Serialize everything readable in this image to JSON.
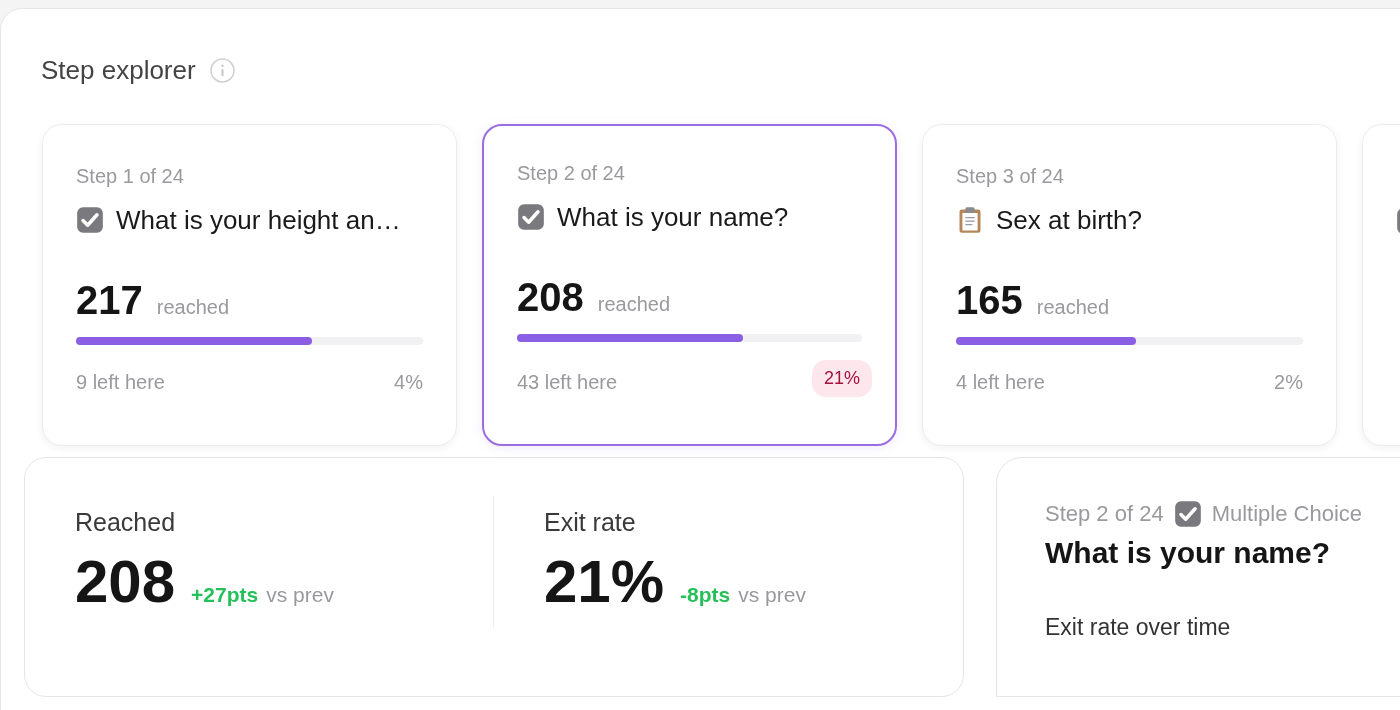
{
  "header": {
    "title": "Step explorer"
  },
  "steps": [
    {
      "step": "Step 1 of 24",
      "kind": "checkbox",
      "question": "What is your height an…",
      "count": "217",
      "count_label": "reached",
      "level": 0.68,
      "left": "9 left here",
      "percent": "4%",
      "alert": false,
      "selected": false
    },
    {
      "step": "Step 2 of 24",
      "kind": "checkbox",
      "question": "What is your name?",
      "count": "208",
      "count_label": "reached",
      "level": 0.655,
      "left": "43 left here",
      "percent": "21%",
      "alert": true,
      "selected": true
    },
    {
      "step": "Step 3 of 24",
      "kind": "clipboard",
      "question": "Sex at birth?",
      "count": "165",
      "count_label": "reached",
      "level": 0.52,
      "left": "4 left here",
      "percent": "2%",
      "alert": false,
      "selected": false
    },
    {
      "kind": "checkbox",
      "selected": false
    }
  ],
  "stats": [
    {
      "label": "Reached",
      "value": "208",
      "delta": "+27pts",
      "suffix": "vs prev"
    },
    {
      "label": "Exit rate",
      "value": "21%",
      "delta": "-8pts",
      "suffix": "vs prev"
    }
  ],
  "detail": {
    "step": "Step 2 of 24",
    "kind": "checkbox",
    "type": "Multiple Choice",
    "question": "What is your name?",
    "section": "Exit rate over time"
  }
}
